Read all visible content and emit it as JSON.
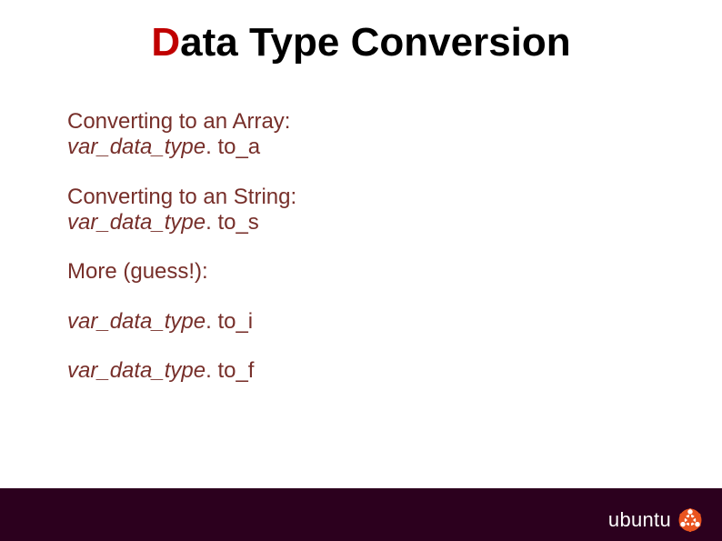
{
  "title": {
    "accent_letter": "D",
    "rest": "ata Type Conversion"
  },
  "sections": [
    {
      "label": "Converting to an Array:",
      "code_prefix": "var_data_type",
      "code_method": ". to_a"
    },
    {
      "label": "Converting to an String:",
      "code_prefix": "var_data_type",
      "code_method": ". to_s"
    },
    {
      "label": "More (guess!):",
      "code_prefix": "",
      "code_method": ""
    }
  ],
  "extra_codes": [
    {
      "code_prefix": "var_data_type",
      "code_method": ". to_i"
    },
    {
      "code_prefix": "var_data_type",
      "code_method": ". to_f"
    }
  ],
  "footer": {
    "logo_text": "ubuntu",
    "logo_icon_name": "ubuntu-circle-of-friends-icon"
  }
}
